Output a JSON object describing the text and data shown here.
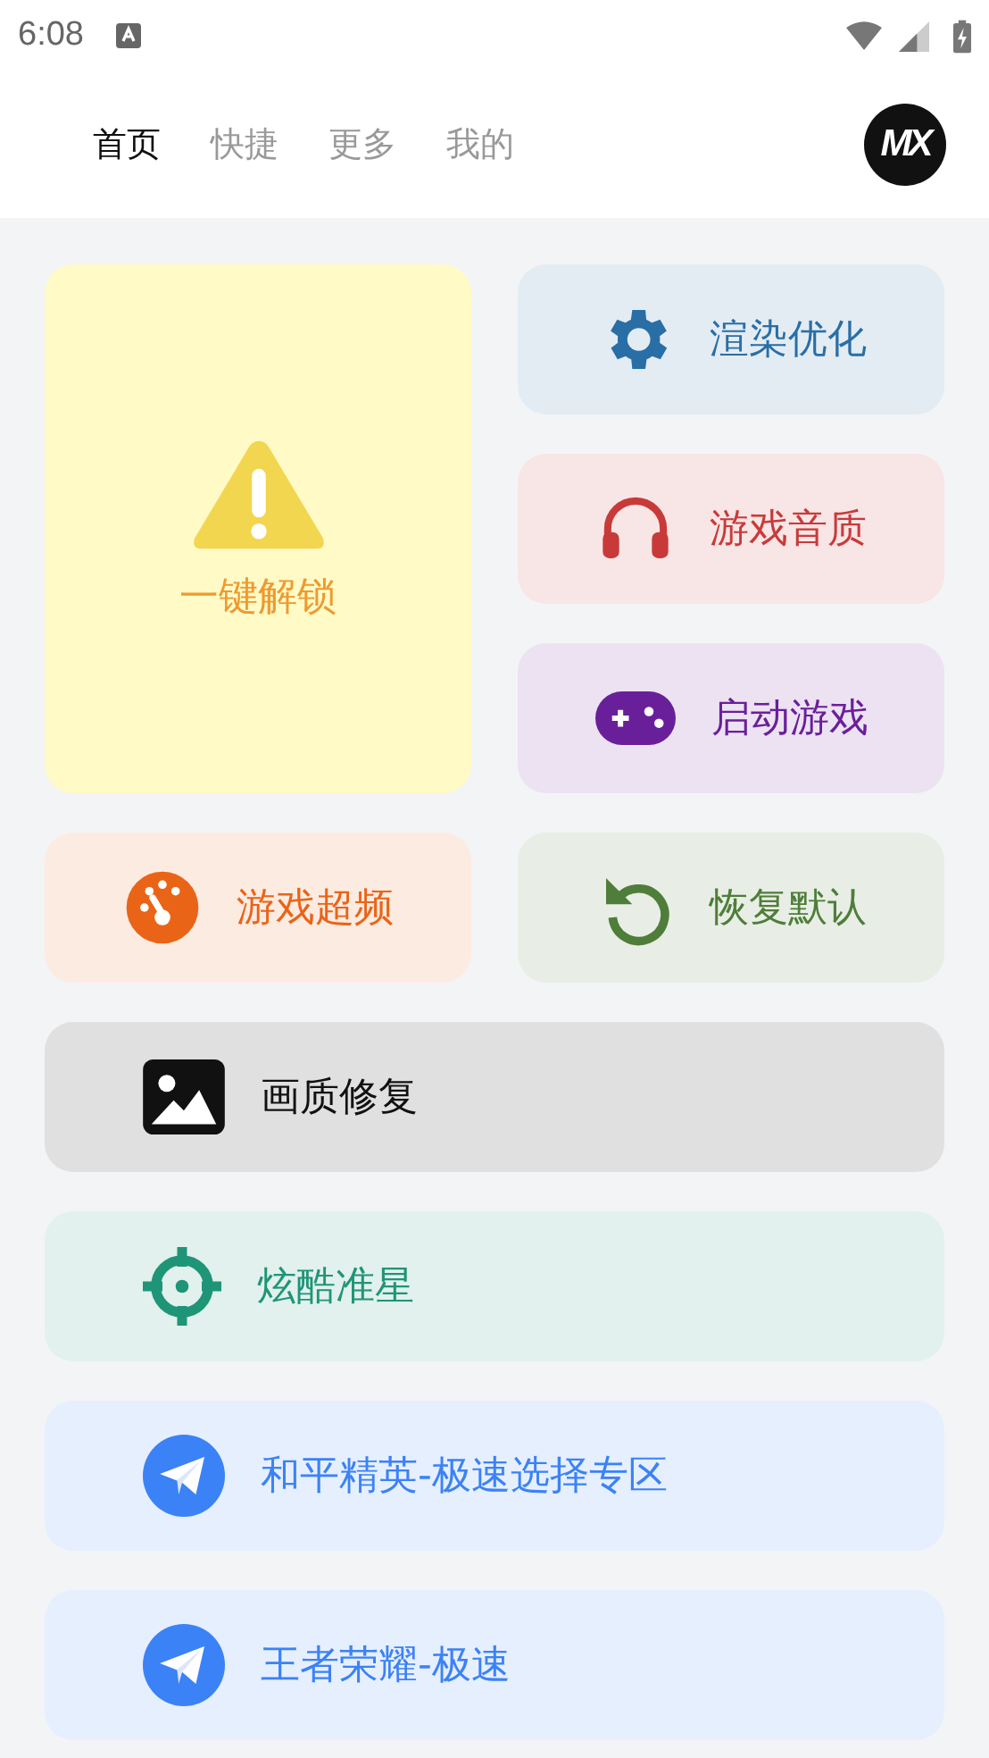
{
  "status_bar": {
    "time": "6:08"
  },
  "tabs": [
    {
      "label": "首页",
      "selected": true
    },
    {
      "label": "快捷",
      "selected": false
    },
    {
      "label": "更多",
      "selected": false
    },
    {
      "label": "我的",
      "selected": false
    }
  ],
  "logo": {
    "text": "MX"
  },
  "cards": [
    {
      "kind": "tall",
      "label": "一键解锁",
      "color": "#ee9a30"
    },
    {
      "kind": "half",
      "label": "渲染优化",
      "color": "#2a6ea6"
    },
    {
      "kind": "half",
      "label": "游戏音质",
      "color": "#c83a3a"
    },
    {
      "kind": "half",
      "label": "启动游戏",
      "color": "#6a1f9a"
    },
    {
      "kind": "half",
      "label": "游戏超频",
      "color": "#ea6417"
    },
    {
      "kind": "half",
      "label": "恢复默认",
      "color": "#4f7d3a"
    },
    {
      "kind": "wide",
      "label": "画质修复",
      "color": "#111111"
    },
    {
      "kind": "wide",
      "label": "炫酷准星",
      "color": "#1f9577"
    },
    {
      "kind": "wide",
      "label": "和平精英-极速选择专区",
      "color": "#3b82f6"
    },
    {
      "kind": "wide",
      "label": "王者荣耀-极速",
      "color": "#3b82f6"
    }
  ]
}
